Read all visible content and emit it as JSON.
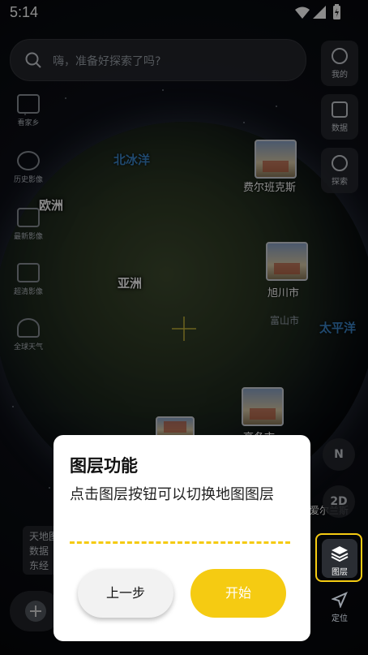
{
  "status_bar": {
    "time": "5:14"
  },
  "search": {
    "placeholder": "嗨，准备好探索了吗?"
  },
  "left_tools": [
    {
      "label": "看家乡",
      "icon": "image-720-icon"
    },
    {
      "label": "历史影像",
      "icon": "history-clock-icon"
    },
    {
      "label": "最新影像",
      "icon": "latest-image-icon"
    },
    {
      "label": "超清影像",
      "icon": "hd-image-icon"
    },
    {
      "label": "全球天气",
      "icon": "weather-icon"
    }
  ],
  "right_tools": [
    {
      "label": "我的",
      "icon": "user-icon"
    },
    {
      "label": "数据",
      "icon": "data-icon"
    },
    {
      "label": "探索",
      "icon": "compass-icon"
    }
  ],
  "map": {
    "labels": {
      "north_ocean": "北冰洋",
      "europe": "欧洲",
      "asia": "亚洲",
      "pacific": "太平洋",
      "fairbanks": "费尔班克斯",
      "asahikawa": "旭川市",
      "toyama": "富山市",
      "ireland": "爱尔兰斯",
      "bottom_city": "高冬市"
    }
  },
  "controls": {
    "compass": "N",
    "mode_2d": "2D"
  },
  "layer_button": {
    "label": "图层",
    "icon": "layers-icon"
  },
  "locate_button": {
    "label": "定位",
    "icon": "locate-arrow-icon"
  },
  "info_card": {
    "lines": [
      "天地图",
      "数据",
      "东经"
    ]
  },
  "dialog": {
    "title": "图层功能",
    "body": "点击图层按钮可以切换地图图层",
    "prev_label": "上一步",
    "start_label": "开始"
  },
  "colors": {
    "accent": "#f5cb12",
    "ocean_label": "#3b86c9"
  }
}
